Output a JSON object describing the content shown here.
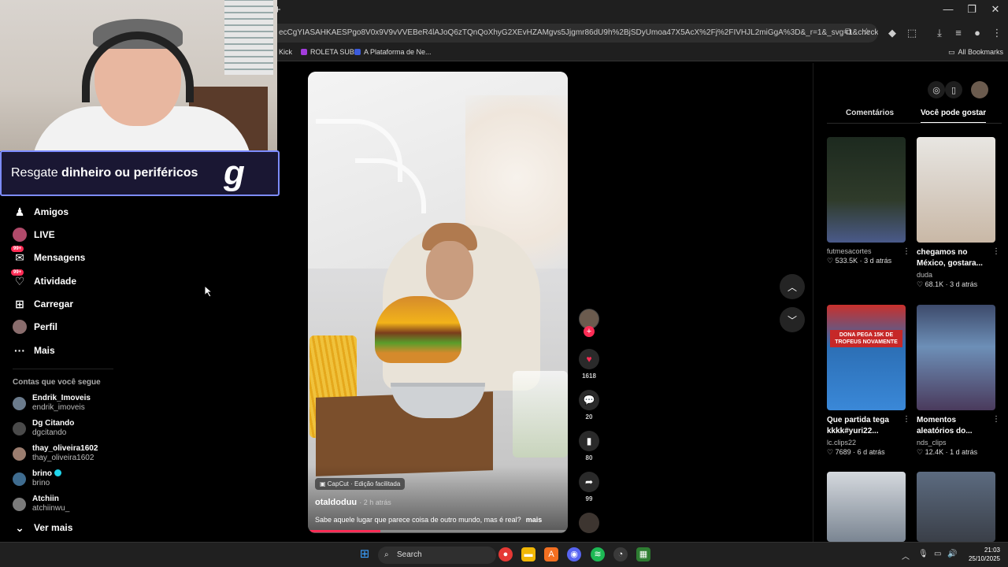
{
  "browser": {
    "new_tab": "+",
    "url": "ecCgYIASAHKAESPgo8V0x9V9vVVEBeR4lAJoQ6zTQnQoXhyG2XEvHZAMgvs5Jjgmr86dU9h%2BjSDyUmoa47X5AcX%2Fj%2FIVHJL2miGgA%3D&_r=1&_svg=1&checksum=4...",
    "bookmarks": [
      {
        "label": "Kick",
        "color": "#53fc18"
      },
      {
        "label": "ROLETA SUB",
        "color": "#a23cdb"
      },
      {
        "label": "A Plataforma de Ne...",
        "color": "#3b5bdb"
      }
    ],
    "all_bookmarks": "All Bookmarks",
    "window_controls": [
      "—",
      "❐",
      "✕"
    ]
  },
  "overlay": {
    "banner_prefix": "Resgate ",
    "banner_bold": "dinheiro ou periféricos",
    "logo_letter": "g"
  },
  "nav": {
    "items": [
      {
        "label": "Amigos",
        "icon": "friends-icon",
        "glyph": "👥"
      },
      {
        "label": "LIVE",
        "icon": "live-icon",
        "glyph": ""
      },
      {
        "label": "Mensagens",
        "icon": "messages-icon",
        "glyph": "✉",
        "badge": "99+"
      },
      {
        "label": "Atividade",
        "icon": "activity-icon",
        "glyph": "♥",
        "badge": "99+"
      },
      {
        "label": "Carregar",
        "icon": "upload-icon",
        "glyph": "⊞"
      },
      {
        "label": "Perfil",
        "icon": "profile-icon",
        "glyph": ""
      },
      {
        "label": "Mais",
        "icon": "more-icon",
        "glyph": "···"
      }
    ],
    "following_title": "Contas que você segue",
    "following": [
      {
        "name": "Endrik_Imoveis",
        "handle": "endrik_imoveis",
        "color": "#6b7b8c"
      },
      {
        "name": "Dg Citando",
        "handle": "dgcitando",
        "color": "#4a4a4a"
      },
      {
        "name": "thay_oliveira1602",
        "handle": "thay_oliveira1602",
        "color": "#9b7d6f"
      },
      {
        "name": "brino",
        "handle": "brino",
        "color": "#3f6c8f",
        "verified": true
      },
      {
        "name": "Atchiin",
        "handle": "atchiinwu_",
        "color": "#7a7a7a"
      }
    ],
    "see_more": "Ver mais"
  },
  "video": {
    "capcut": "CapCut · Edição facilitada",
    "author": "otaldoduu",
    "time": "· 2 h atrás",
    "description": "Sabe aquele lugar que parece coisa de outro mundo, mas é real?",
    "more": "mais",
    "progress": 0.28,
    "likes": "1618",
    "comments": "20",
    "saves": "80",
    "shares": "99"
  },
  "right_panel": {
    "tabs": [
      "Comentários",
      "Você pode gostar"
    ],
    "active_tab": "Você pode gostar",
    "cards": [
      {
        "title": "",
        "user": "futmesacortes",
        "likes": "533.5K",
        "age": "3 d atrás",
        "bg": "linear-gradient(180deg,#1d2a1f 0%,#2f3b2a 60%,#4a5a8a 100%)"
      },
      {
        "title": "chegamos no México, gostara...",
        "user": "duda",
        "likes": "68.1K",
        "age": "3 d atrás",
        "bg": "linear-gradient(180deg,#e8e6e2 0%,#d8cfc5 50%,#c9b8a6 100%)"
      },
      {
        "title": "Que partida tega kkkk#yuri22...",
        "user": "lc.clips22",
        "likes": "7689",
        "age": "6 d atrás",
        "bg": "linear-gradient(180deg,#c9302c 0%,#2c6fb5 40%,#3a88d8 100%)"
      },
      {
        "title": "Momentos aleatórios do...",
        "user": "nds_clips",
        "likes": "12.4K",
        "age": "1 d atrás",
        "bg": "linear-gradient(180deg,#3d4a6b 0%,#6d8fb7 40%,#4a3a5c 100%)"
      },
      {
        "title": "",
        "user": "",
        "likes": "",
        "age": "",
        "bg": "linear-gradient(180deg,#d5d9de 0%,#7a8592 100%)"
      },
      {
        "title": "",
        "user": "",
        "likes": "",
        "age": "",
        "bg": "linear-gradient(180deg,#5c6b80 0%,#3a3f48 100%)"
      }
    ],
    "banner_text": "DONA PEGA 15K DE TROFEUS NOVAMENTE"
  },
  "taskbar": {
    "search": "Search",
    "time": "21:03",
    "date": "25/10/2025"
  }
}
